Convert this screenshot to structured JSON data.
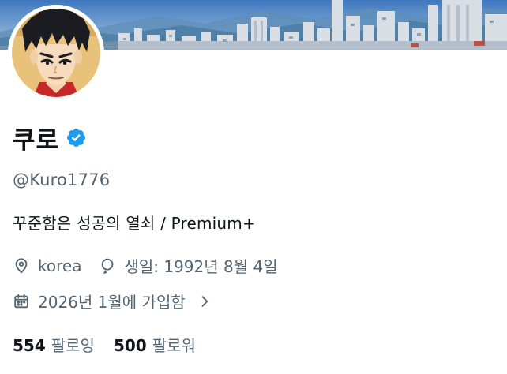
{
  "profile": {
    "display_name": "쿠로",
    "verified": true,
    "handle": "@Kuro1776",
    "bio": "꾸준함은 성공의 열쇠 / Premium+",
    "location": "korea",
    "birthday": "생일: 1992년 8월 4일",
    "joined": "2026년 1월에 가입함",
    "following_count": "554",
    "following_label": "팔로잉",
    "followers_count": "500",
    "followers_label": "팔로워"
  },
  "icons": {
    "verified": "verified-badge-icon",
    "location": "location-pin-icon",
    "birthday": "balloon-icon",
    "joined": "calendar-icon",
    "expand": "chevron-right-icon"
  },
  "colors": {
    "text_primary": "#0f1419",
    "text_secondary": "#536471",
    "verified_blue": "#1d9bf0"
  }
}
